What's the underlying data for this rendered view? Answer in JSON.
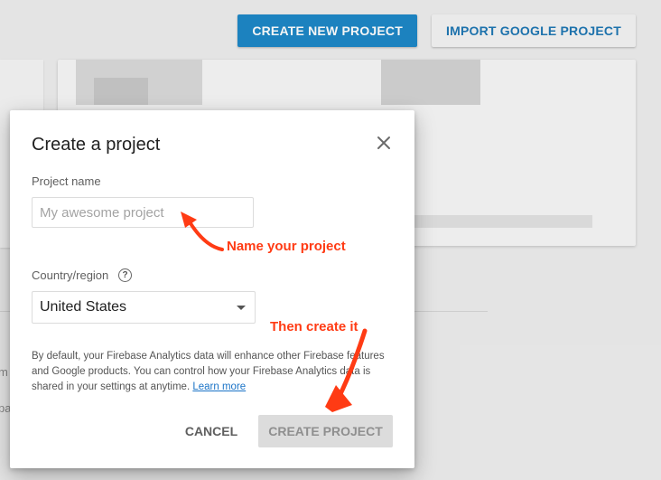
{
  "background": {
    "create_new_label": "CREATE NEW PROJECT",
    "import_label": "IMPORT GOOGLE PROJECT",
    "partial_text_1": "m",
    "partial_text_2": "pa"
  },
  "dialog": {
    "title": "Create a project",
    "project_name": {
      "label": "Project name",
      "value": "",
      "placeholder": "My awesome project"
    },
    "country": {
      "label": "Country/region",
      "selected": "United States"
    },
    "disclaimer": "By default, your Firebase Analytics data will enhance other Firebase features and Google products. You can control how your Firebase Analytics data is shared in your settings at anytime.",
    "learn_more": "Learn more",
    "cancel_label": "CANCEL",
    "create_label": "CREATE PROJECT"
  },
  "annotations": {
    "name_hint": "Name your project",
    "create_hint": "Then create it",
    "color": "#ff3b14"
  },
  "colors": {
    "primary": "#1e88c7",
    "link": "#1a73c7"
  }
}
